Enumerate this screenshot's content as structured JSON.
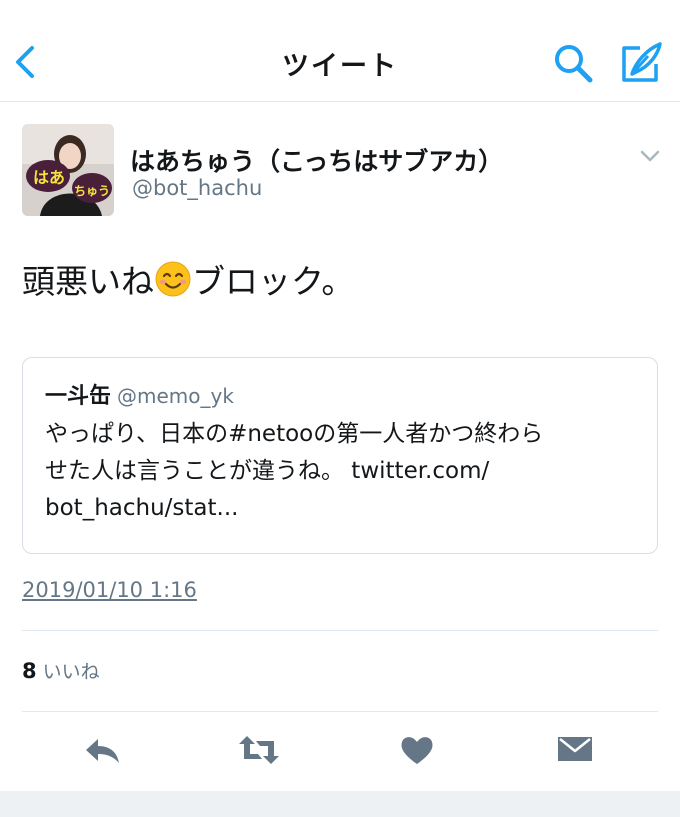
{
  "nav": {
    "title": "ツイート"
  },
  "author": {
    "name": "はあちゅう（こっちはサブアカ）",
    "handle": "@bot_hachu"
  },
  "avatar_text": {
    "line1": "はあ",
    "line2": "ちゅう"
  },
  "tweet": {
    "text_before_emoji": "頭悪いね",
    "emoji": "smiling-face-with-smiling-eyes",
    "text_after_emoji": "ブロック。"
  },
  "quote": {
    "name": "一斗缶",
    "handle": "@memo_yk",
    "lines": [
      "やっぱり、日本の#netooの第一人者かつ終わら",
      "せた人は言うことが違うね。 twitter.com/",
      "bot_hachu/stat..."
    ]
  },
  "timestamp": "2019/01/10 1:16",
  "likes": {
    "count": "8",
    "label": "いいね"
  },
  "icons": [
    "back-chevron",
    "search",
    "compose",
    "caret-down",
    "reply",
    "retweet",
    "heart",
    "direct-message"
  ],
  "colors": {
    "accent": "#1da1f2",
    "icon_gray": "#657786",
    "text": "#14171a",
    "border": "#e1e8ed"
  }
}
